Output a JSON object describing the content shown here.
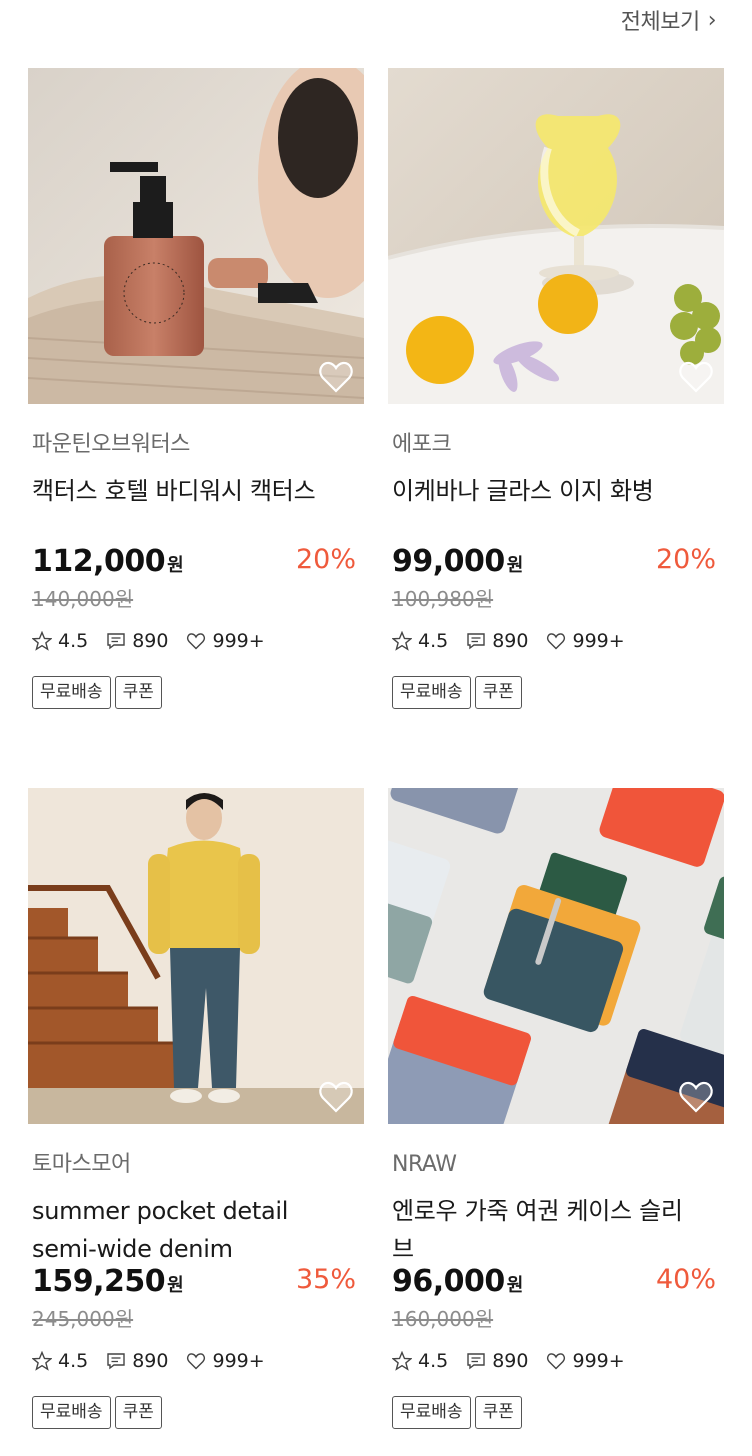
{
  "header": {
    "view_all": "전체보기"
  },
  "products": [
    {
      "brand": "파운틴오브워터스",
      "name": "캑터스 호텔 바디워시 캑터스",
      "price": "112,000",
      "currency": "원",
      "discount": "20%",
      "original_price": "140,000원",
      "rating": "4.5",
      "reviews": "890",
      "likes": "999+",
      "tags": [
        "무료배송",
        "쿠폰"
      ]
    },
    {
      "brand": "에포크",
      "name": "이케바나 글라스 이지 화병",
      "price": "99,000",
      "currency": "원",
      "discount": "20%",
      "original_price": "100,980원",
      "rating": "4.5",
      "reviews": "890",
      "likes": "999+",
      "tags": [
        "무료배송",
        "쿠폰"
      ]
    },
    {
      "brand": "토마스모어",
      "name": "summer pocket detail semi-wide denim",
      "price": "159,250",
      "currency": "원",
      "discount": "35%",
      "original_price": "245,000원",
      "rating": "4.5",
      "reviews": "890",
      "likes": "999+",
      "tags": [
        "무료배송",
        "쿠폰"
      ]
    },
    {
      "brand": "NRAW",
      "name": "엔로우 가죽 여권 케이스 슬리브",
      "price": "96,000",
      "currency": "원",
      "discount": "40%",
      "original_price": "160,000원",
      "rating": "4.5",
      "reviews": "890",
      "likes": "999+",
      "tags": [
        "무료배송",
        "쿠폰"
      ]
    }
  ],
  "colors": {
    "discount": "#ef5a3c",
    "brand_text": "#6b6b6b",
    "strike_text": "#8c8c8c"
  }
}
